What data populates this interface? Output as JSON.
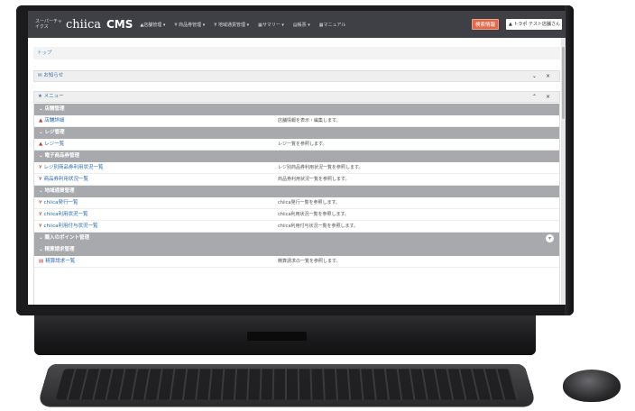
{
  "navbar": {
    "brand_sub": "スーパーチャイクス",
    "brand_logo": "chiica",
    "brand_cms": "CMS",
    "items": [
      "▲店舗管理 ▾",
      "¥ 商品券管理 ▾",
      "¥ 地域通貨管理 ▾",
      "▦サマリー ▾",
      "▤帳票 ▾",
      "▦マニュアル"
    ],
    "red_button": "検索情報",
    "user_menu": "▲ トラポ テスト店舗さん ▾"
  },
  "breadcrumb": "トップ",
  "panels": {
    "news": {
      "title": "✉ お知らせ",
      "controls": "⌄ ×"
    },
    "menu": {
      "title": "★ メニュー",
      "controls": "⌃ ×"
    }
  },
  "menu": {
    "sec_store": "⌄ 店舗管理",
    "store_detail_link": "店舗詳細",
    "store_detail_desc": "店舗情報を表示・編集します。",
    "sec_register": "⌄ レジ管理",
    "register_list_link": "レジ一覧",
    "register_list_desc": "レジ一覧を参照します。",
    "sec_ticket": "⌄ 電子商品券管理",
    "ticket_by_register_link": "レジ別商品券利用状況一覧",
    "ticket_by_register_desc": "レジ別商品券利用状況一覧を参照します。",
    "ticket_usage_link": "商品券利用状況一覧",
    "ticket_usage_desc": "商品券利用状況一覧を参照します。",
    "sec_local_currency": "⌄ 地域通貨管理",
    "chiica_issue_link": "chiica発行一覧",
    "chiica_issue_desc": "chiica発行一覧を参照します。",
    "chiica_usage_link": "chiica利用状況一覧",
    "chiica_usage_desc": "chiica利用状況一覧を参照します。",
    "chiica_grant_link": "chiica利用付与状況一覧",
    "chiica_grant_desc": "chiica利用付与状況一覧を参照します。",
    "sec_points": "⌄ 購入のポイント管理",
    "sec_billing": "⌄ 精算請求管理",
    "billing_list_link": "精算請求一覧",
    "billing_list_desc": "精算請求の一覧を参照します。"
  }
}
